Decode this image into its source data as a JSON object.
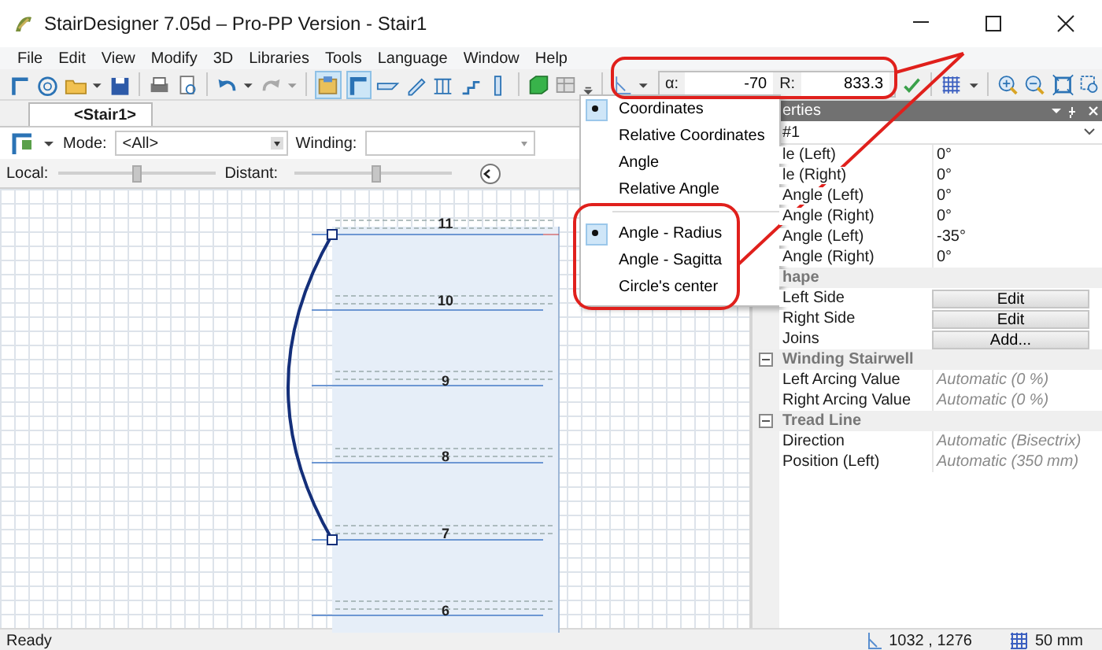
{
  "window": {
    "title": "StairDesigner 7.05d – Pro-PP Version - Stair1"
  },
  "menu": [
    "File",
    "Edit",
    "View",
    "Modify",
    "3D",
    "Libraries",
    "Tools",
    "Language",
    "Window",
    "Help"
  ],
  "coordinate_input": {
    "alpha_label": "α:",
    "alpha": "-70",
    "r_label": "R:",
    "r": "833.3"
  },
  "tabs": [
    {
      "label": "<Stair1>",
      "selected": true
    }
  ],
  "mode_bar": {
    "mode_label": "Mode:",
    "mode": "<All>",
    "winding_label": "Winding:"
  },
  "sliders": [
    {
      "label": "Local:",
      "level": 0.5
    },
    {
      "label": "Distant:",
      "level": 0.52
    }
  ],
  "step_numbers": [
    "11",
    "10",
    "9",
    "8",
    "7",
    "6"
  ],
  "coordinate_menu": {
    "groups": [
      [
        {
          "label": "Coordinates",
          "selected": true
        },
        {
          "label": "Relative Coordinates",
          "selected": false
        },
        {
          "label": "Angle",
          "selected": false
        },
        {
          "label": "Relative Angle",
          "selected": false
        }
      ],
      [
        {
          "label": "Angle - Radius",
          "selected": true
        },
        {
          "label": "Angle - Sagitta",
          "selected": false
        },
        {
          "label": "Circle's center",
          "selected": false
        }
      ]
    ]
  },
  "properties": {
    "title": "erties",
    "object": "#1",
    "rows": [
      {
        "kind": "property",
        "name": "le (Left)",
        "value": "0°"
      },
      {
        "kind": "property",
        "name": "le (Right)",
        "value": "0°"
      },
      {
        "kind": "property",
        "name": "Angle (Left)",
        "value": "0°"
      },
      {
        "kind": "property",
        "name": "Angle (Right)",
        "value": "0°"
      },
      {
        "kind": "property",
        "name": "Angle (Left)",
        "value": "-35°"
      },
      {
        "kind": "property",
        "name": "Angle (Right)",
        "value": "0°"
      },
      {
        "kind": "group",
        "name": "hape"
      },
      {
        "kind": "button",
        "name": "Left Side",
        "button": "Edit"
      },
      {
        "kind": "button",
        "name": "Right Side",
        "button": "Edit"
      },
      {
        "kind": "button",
        "name": "Joins",
        "button": "Add..."
      },
      {
        "kind": "group",
        "name": "Winding Stairwell",
        "expanded": true
      },
      {
        "kind": "property",
        "name": "Left Arcing Value",
        "value": "Automatic (0 %)",
        "automatic": true
      },
      {
        "kind": "property",
        "name": "Right Arcing Value",
        "value": "Automatic (0 %)",
        "automatic": true
      },
      {
        "kind": "group",
        "name": "Tread Line",
        "expanded": true
      },
      {
        "kind": "property",
        "name": "Direction",
        "value": "Automatic (Bisectrix)",
        "automatic": true
      },
      {
        "kind": "property",
        "name": "Position (Left)",
        "value": "Automatic (350 mm)",
        "automatic": true
      }
    ]
  },
  "status_bar": {
    "text": "Ready",
    "coordinates": "1032 , 1276",
    "grid": "50 mm"
  }
}
